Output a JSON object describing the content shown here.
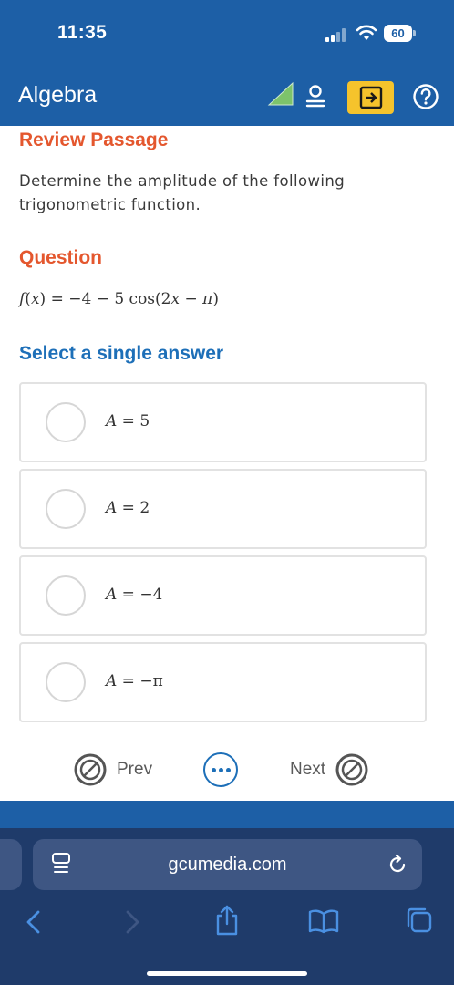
{
  "status_bar": {
    "time": "11:35",
    "battery": "60"
  },
  "header": {
    "title": "Algebra",
    "icons": [
      "flag-icon",
      "person-icon",
      "exit-icon",
      "help-icon"
    ],
    "accent_color": "#1d5fa6",
    "exit_button_color": "#f5c32c"
  },
  "content": {
    "review_passage": "Review Passage",
    "prompt": "Determine the amplitude of the following trigonometric function.",
    "question_heading": "Question",
    "select_heading": "Select a single answer",
    "options": [
      {
        "var": "A",
        "rhs": "5"
      },
      {
        "var": "A",
        "rhs": "2"
      },
      {
        "var": "A",
        "rhs": "−4"
      },
      {
        "var": "A",
        "rhs": "−π"
      }
    ]
  },
  "nav": {
    "prev_label": "Prev",
    "next_label": "Next"
  },
  "browser": {
    "url": "gcumedia.com",
    "toolbar_icons": [
      "back-icon",
      "forward-icon",
      "share-icon",
      "bookmarks-icon",
      "tabs-icon"
    ]
  }
}
